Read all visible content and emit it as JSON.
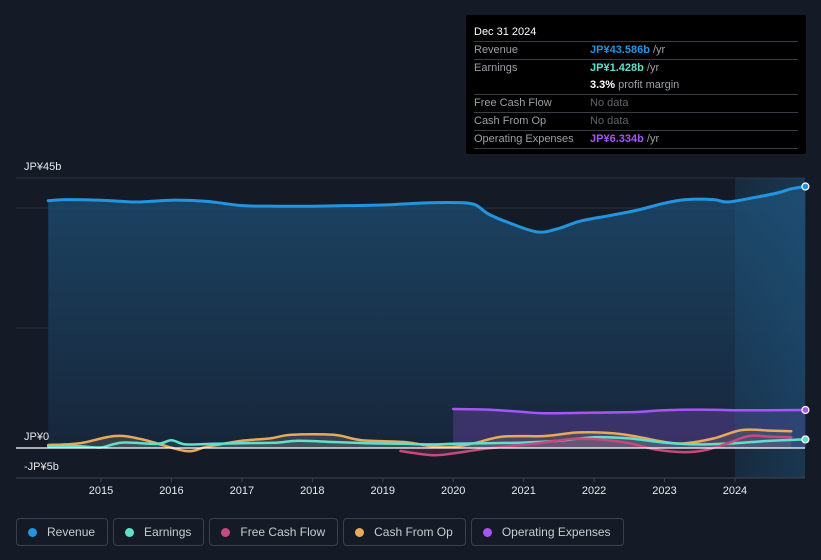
{
  "tooltip": {
    "date": "Dec 31 2024",
    "rows": [
      {
        "label": "Revenue",
        "value": "JP¥43.586b",
        "unit": " /yr",
        "color": "#2394df"
      },
      {
        "label": "Earnings",
        "value": "JP¥1.428b",
        "unit": " /yr",
        "color": "#5fe0cc"
      },
      {
        "label": "",
        "value": "3.3%",
        "unit": " profit margin",
        "color": "#ffffff"
      },
      {
        "label": "Free Cash Flow",
        "value": "No data"
      },
      {
        "label": "Cash From Op",
        "value": "No data"
      },
      {
        "label": "Operating Expenses",
        "value": "JP¥6.334b",
        "unit": " /yr",
        "color": "#a855f7"
      }
    ]
  },
  "legend": [
    {
      "label": "Revenue",
      "color": "#2394df"
    },
    {
      "label": "Earnings",
      "color": "#5fe0cc"
    },
    {
      "label": "Free Cash Flow",
      "color": "#c8487f"
    },
    {
      "label": "Cash From Op",
      "color": "#e8a95b"
    },
    {
      "label": "Operating Expenses",
      "color": "#a855f7"
    }
  ],
  "chart_data": {
    "type": "area",
    "title": "",
    "xlabel": "",
    "ylabel": "",
    "units": "JP¥ billions",
    "ylim": [
      -5,
      45
    ],
    "xlim": [
      2014.25,
      2025.0
    ],
    "y_ticks": [
      {
        "value": 45,
        "label": "JP¥45b"
      },
      {
        "value": 0,
        "label": "JP¥0"
      },
      {
        "value": -5,
        "label": "-JP¥5b"
      }
    ],
    "gridlines": [
      45,
      40,
      20,
      0
    ],
    "x_ticks": [
      2015,
      2016,
      2017,
      2018,
      2019,
      2020,
      2021,
      2022,
      2023,
      2024
    ],
    "highlight_range": [
      2024.0,
      2025.0
    ],
    "series": [
      {
        "name": "Revenue",
        "color": "#2394df",
        "fill": true,
        "points": [
          [
            2014.25,
            41.2
          ],
          [
            2014.5,
            41.4
          ],
          [
            2015.0,
            41.3
          ],
          [
            2015.5,
            41.0
          ],
          [
            2016.0,
            41.3
          ],
          [
            2016.5,
            41.1
          ],
          [
            2017.0,
            40.4
          ],
          [
            2017.5,
            40.3
          ],
          [
            2018.0,
            40.3
          ],
          [
            2018.5,
            40.4
          ],
          [
            2019.0,
            40.5
          ],
          [
            2019.5,
            40.8
          ],
          [
            2020.0,
            40.9
          ],
          [
            2020.3,
            40.6
          ],
          [
            2020.5,
            39.0
          ],
          [
            2020.8,
            37.5
          ],
          [
            2021.2,
            36.0
          ],
          [
            2021.5,
            36.6
          ],
          [
            2021.8,
            37.8
          ],
          [
            2022.2,
            38.7
          ],
          [
            2022.6,
            39.6
          ],
          [
            2023.0,
            40.8
          ],
          [
            2023.3,
            41.4
          ],
          [
            2023.7,
            41.4
          ],
          [
            2023.9,
            41.0
          ],
          [
            2024.3,
            41.8
          ],
          [
            2024.6,
            42.5
          ],
          [
            2024.8,
            43.2
          ],
          [
            2025.0,
            43.586
          ]
        ]
      },
      {
        "name": "Operating Expenses",
        "color": "#a855f7",
        "fill": true,
        "points": [
          [
            2020.0,
            6.5
          ],
          [
            2020.5,
            6.4
          ],
          [
            2021.0,
            6.0
          ],
          [
            2021.3,
            5.8
          ],
          [
            2022.0,
            5.9
          ],
          [
            2022.6,
            6.0
          ],
          [
            2023.0,
            6.3
          ],
          [
            2023.5,
            6.4
          ],
          [
            2024.0,
            6.3
          ],
          [
            2024.5,
            6.3
          ],
          [
            2025.0,
            6.334
          ]
        ]
      },
      {
        "name": "Cash From Op",
        "color": "#e8a95b",
        "fill": true,
        "points": [
          [
            2014.25,
            0.5
          ],
          [
            2014.7,
            0.8
          ],
          [
            2015.2,
            2.0
          ],
          [
            2015.6,
            1.4
          ],
          [
            2016.2,
            -0.5
          ],
          [
            2016.5,
            0.2
          ],
          [
            2017.0,
            1.2
          ],
          [
            2017.4,
            1.6
          ],
          [
            2017.7,
            2.2
          ],
          [
            2018.3,
            2.2
          ],
          [
            2018.7,
            1.3
          ],
          [
            2019.3,
            1.0
          ],
          [
            2019.7,
            0.3
          ],
          [
            2020.0,
            0.2
          ],
          [
            2020.3,
            0.8
          ],
          [
            2020.7,
            1.9
          ],
          [
            2021.3,
            2.0
          ],
          [
            2021.8,
            2.6
          ],
          [
            2022.4,
            2.3
          ],
          [
            2023.0,
            1.0
          ],
          [
            2023.3,
            0.8
          ],
          [
            2023.7,
            1.6
          ],
          [
            2024.1,
            3.0
          ],
          [
            2024.5,
            2.9
          ],
          [
            2024.8,
            2.8
          ]
        ]
      },
      {
        "name": "Earnings",
        "color": "#5fe0cc",
        "fill": true,
        "points": [
          [
            2014.25,
            0.3
          ],
          [
            2014.7,
            0.3
          ],
          [
            2015.0,
            0.1
          ],
          [
            2015.3,
            0.9
          ],
          [
            2015.8,
            0.7
          ],
          [
            2016.0,
            1.3
          ],
          [
            2016.2,
            0.6
          ],
          [
            2016.6,
            0.7
          ],
          [
            2017.0,
            0.8
          ],
          [
            2017.5,
            0.9
          ],
          [
            2017.8,
            1.2
          ],
          [
            2018.3,
            1.0
          ],
          [
            2018.8,
            0.8
          ],
          [
            2019.3,
            0.7
          ],
          [
            2019.7,
            0.6
          ],
          [
            2020.0,
            0.7
          ],
          [
            2020.5,
            0.8
          ],
          [
            2021.0,
            0.9
          ],
          [
            2021.5,
            1.2
          ],
          [
            2022.0,
            1.8
          ],
          [
            2022.5,
            1.6
          ],
          [
            2023.0,
            0.9
          ],
          [
            2023.5,
            0.6
          ],
          [
            2024.0,
            0.8
          ],
          [
            2024.5,
            1.2
          ],
          [
            2025.0,
            1.428
          ]
        ]
      },
      {
        "name": "Free Cash Flow",
        "color": "#c8487f",
        "fill": true,
        "points": [
          [
            2019.25,
            -0.5
          ],
          [
            2019.7,
            -1.2
          ],
          [
            2020.0,
            -0.9
          ],
          [
            2020.4,
            -0.2
          ],
          [
            2020.8,
            0.3
          ],
          [
            2021.2,
            0.8
          ],
          [
            2021.7,
            1.5
          ],
          [
            2022.1,
            1.4
          ],
          [
            2022.5,
            0.8
          ],
          [
            2022.9,
            -0.3
          ],
          [
            2023.3,
            -0.7
          ],
          [
            2023.6,
            -0.3
          ],
          [
            2023.9,
            0.8
          ],
          [
            2024.2,
            2.0
          ],
          [
            2024.5,
            1.9
          ],
          [
            2024.8,
            1.8
          ]
        ]
      }
    ]
  }
}
